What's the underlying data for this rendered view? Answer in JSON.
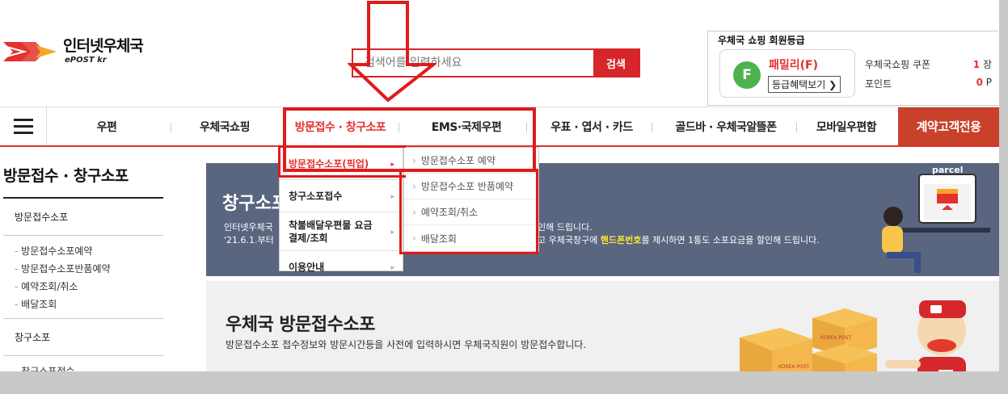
{
  "header": {
    "logo_title": "인터넷우체국",
    "logo_sub": "ePOST kr",
    "search_placeholder": "검색어를 입력하세요",
    "search_button": "검색"
  },
  "member": {
    "title": "우체국 쇼핑 회원등급",
    "grade_letter": "F",
    "grade_name": "패밀리(F)",
    "benefit_button": "등급혜택보기",
    "coupon_label": "우체국쇼핑 쿠폰",
    "coupon_value": "1",
    "coupon_unit": "장",
    "point_label": "포인트",
    "point_value": "0",
    "point_unit": "P"
  },
  "gnb": {
    "items": [
      "우편",
      "우체국쇼핑",
      "방문접수 · 창구소포",
      "EMS·국제우편",
      "우표 · 엽서 · 카드",
      "골드바 · 우체국알뜰폰",
      "모바일우편함"
    ],
    "special": "계약고객전용"
  },
  "dropdown": {
    "left": [
      "방문접수소포(픽업)",
      "창구소포접수",
      "착불배달우편물 요금 결제/조회",
      "이용안내"
    ],
    "right": [
      "방문접수소포 예약",
      "방문접수소포 반품예약",
      "예약조회/취소",
      "배달조회"
    ]
  },
  "lnb": {
    "title": "방문접수 · 창구소포",
    "group1": "방문접수소포",
    "group1_items": [
      "방문접수소포예약",
      "방문접수소포반품예약",
      "예약조회/취소",
      "배달조회"
    ],
    "group2": "창구소포",
    "group2_items": [
      "창구소포접수"
    ]
  },
  "banner1": {
    "title": "창구소포",
    "line1": "인터넷우체국",
    "line2": "'21.6.1.부터",
    "line1_right": "인해 드립니다.",
    "line2_right_pre": "고 우체국창구에",
    "line2_right_em": "핸드폰번호",
    "line2_right_post": "를 제시하면 1통도 소포요금을 할인해 드립니다.",
    "parcel_label": "parcel"
  },
  "banner2": {
    "title": "우체국 방문접수소포",
    "text": "방문접수소포 접수정보와 방문시간등을 사전에 입력하시면 우체국직원이 방문접수합니다.",
    "box_label": "KOREA POST"
  },
  "colors": {
    "brand_red": "#e4312d",
    "annotation_red": "#e01b1b",
    "grade_green": "#4eb14f",
    "banner_blue": "#5a6580",
    "special_orange": "#c8412b"
  }
}
